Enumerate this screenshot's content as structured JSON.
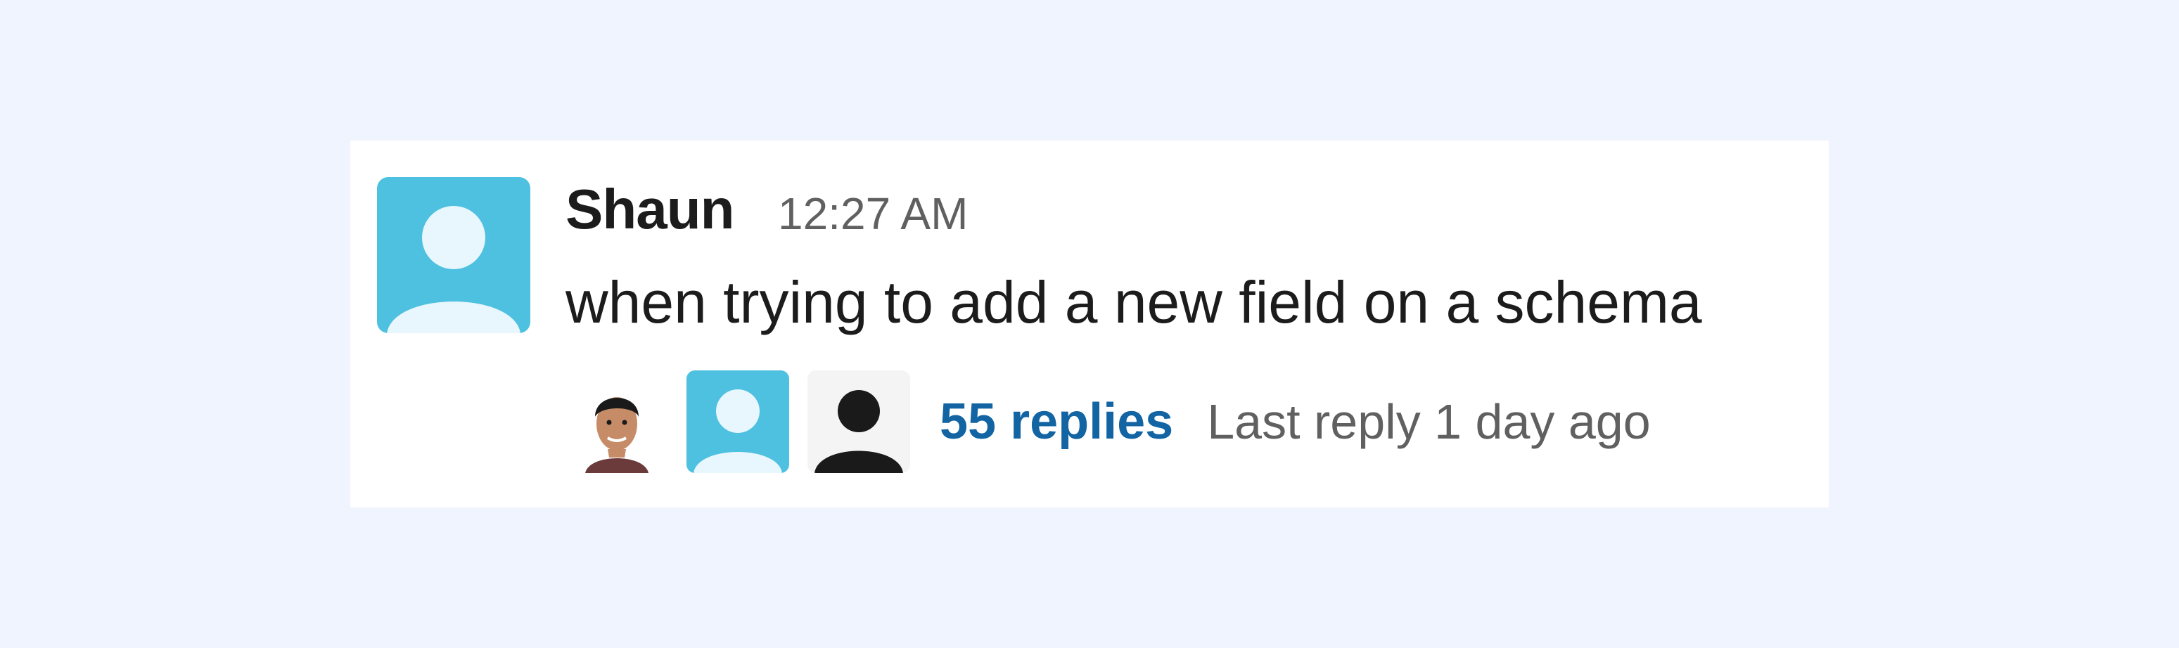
{
  "message": {
    "author": "Shaun",
    "timestamp": "12:27 AM",
    "text": "when trying to add a new field on a schema",
    "avatar_icon": "default-user-avatar-icon"
  },
  "thread": {
    "participants": [
      {
        "avatar_icon": "user-photo-avatar-icon"
      },
      {
        "avatar_icon": "default-user-avatar-icon"
      },
      {
        "avatar_icon": "dark-user-silhouette-icon"
      }
    ],
    "replies_label": "55 replies",
    "last_reply_label": "Last reply 1 day ago"
  },
  "colors": {
    "background": "#f0f4fe",
    "card": "#ffffff",
    "avatar_blue": "#4ec0e0",
    "link_blue": "#1264a3",
    "muted_text": "#616061"
  }
}
